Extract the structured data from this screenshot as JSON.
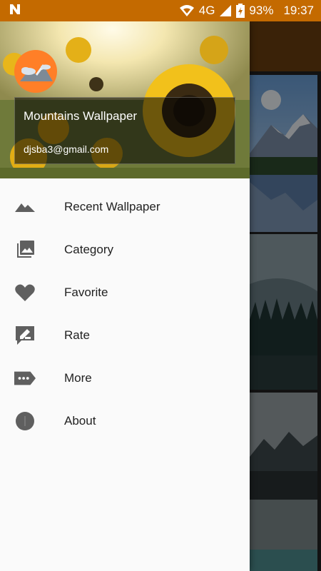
{
  "status_bar": {
    "network": "4G",
    "battery": "93%",
    "time": "19:37",
    "bar_color": "#c46a00"
  },
  "drawer": {
    "title": "Mountains Wallpaper",
    "email": "djsba3@gmail.com",
    "items": [
      {
        "label": "Recent Wallpaper",
        "icon": "mountain-icon"
      },
      {
        "label": "Category",
        "icon": "image-library-icon"
      },
      {
        "label": "Favorite",
        "icon": "heart-icon"
      },
      {
        "label": "Rate",
        "icon": "rate-icon"
      },
      {
        "label": "More",
        "icon": "more-label-icon"
      },
      {
        "label": "About",
        "icon": "info-icon"
      }
    ]
  },
  "colors": {
    "avatar": "#ff7f27",
    "icon_gray": "#5f5f5f",
    "text": "#222222"
  }
}
